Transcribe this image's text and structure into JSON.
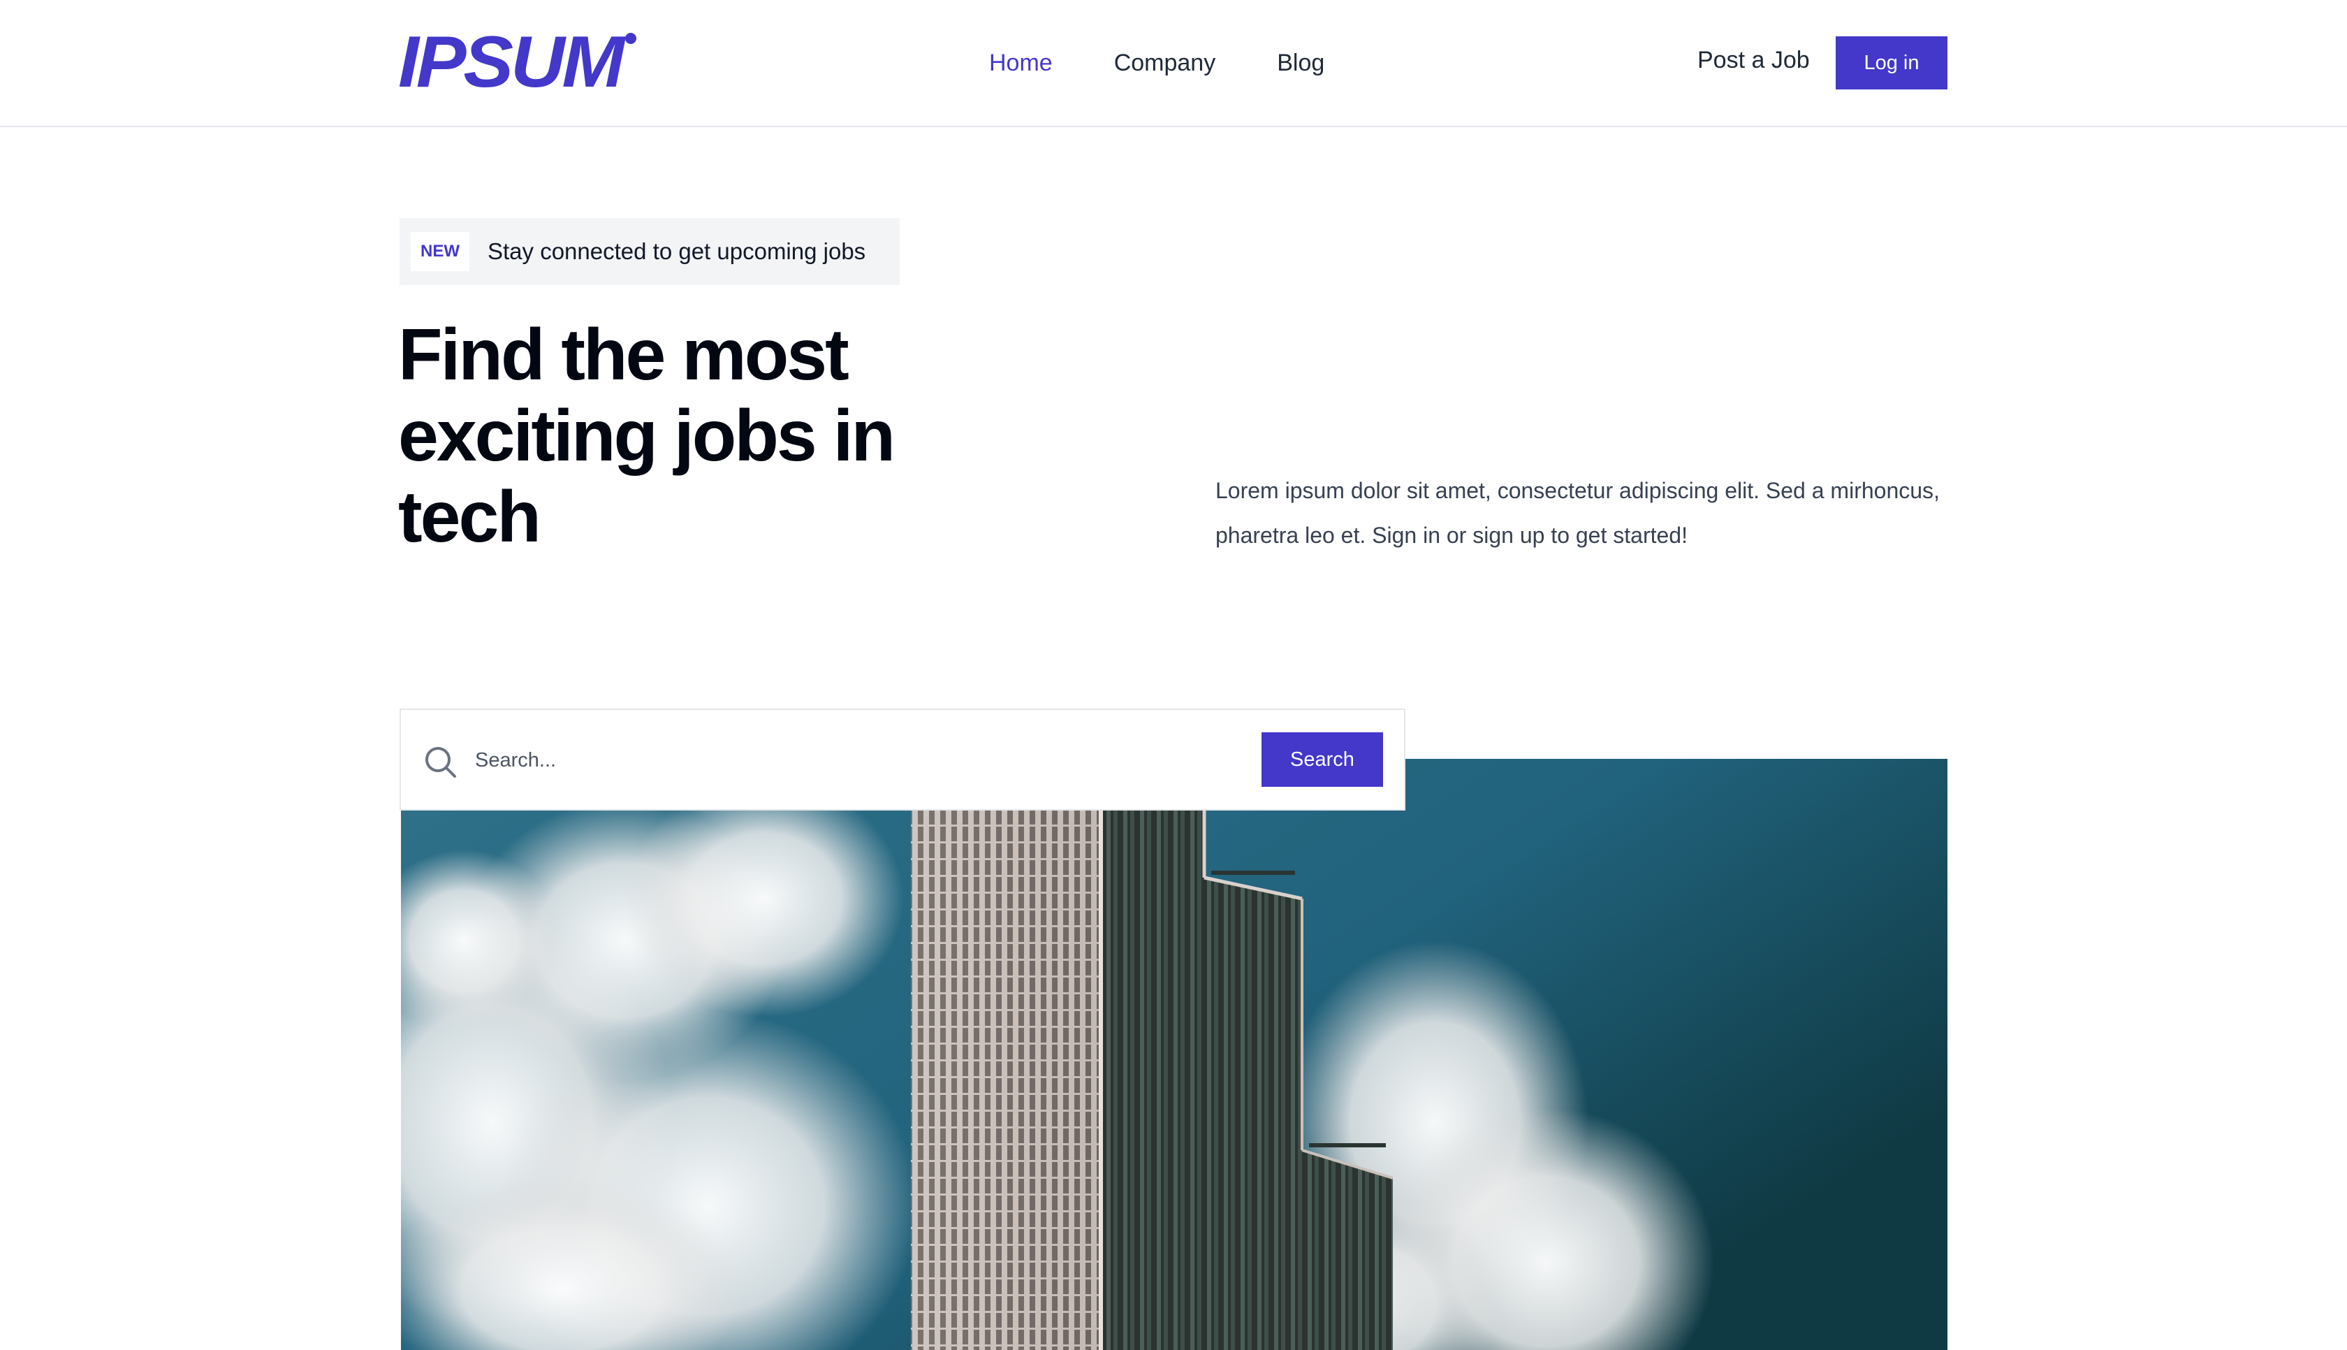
{
  "header": {
    "logo_text": "IPSUM",
    "nav": [
      {
        "label": "Home",
        "active": true
      },
      {
        "label": "Company",
        "active": false
      },
      {
        "label": "Blog",
        "active": false
      }
    ],
    "post_job_label": "Post a Job",
    "login_label": "Log in"
  },
  "hero": {
    "badge_tag": "NEW",
    "badge_text": "Stay connected to get upcoming jobs",
    "headline": "Find the most exciting jobs in tech",
    "description": "Lorem ipsum dolor sit amet, consectetur adipiscing elit. Sed a mirhoncus, pharetra leo et. Sign in or sign up to get started!"
  },
  "search": {
    "placeholder": "Search...",
    "value": "",
    "button_label": "Search",
    "icon": "search-icon"
  },
  "image": {
    "subject": "skyscraper-against-sky-with-clouds"
  },
  "colors": {
    "accent": "#4338ca",
    "text": "#111827",
    "muted_bg": "#f3f4f6",
    "border": "#e5e7eb"
  }
}
